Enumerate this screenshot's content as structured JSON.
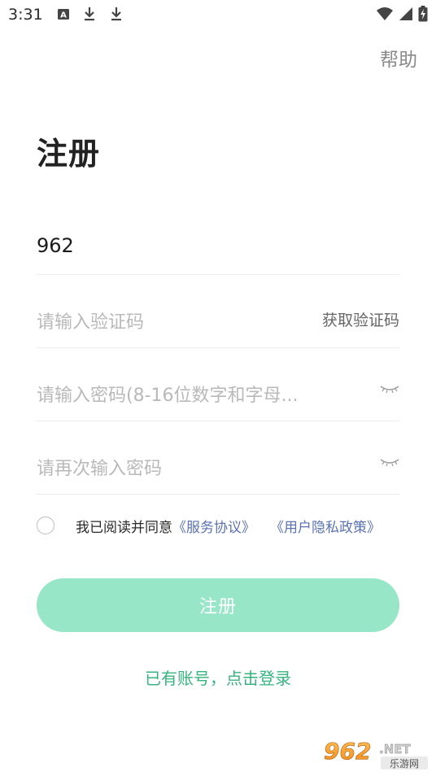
{
  "status_bar": {
    "time": "3:31",
    "icons": [
      "a-letter-icon",
      "download-icon",
      "download-icon",
      "wifi-icon",
      "signal-icon",
      "battery-charging-icon"
    ]
  },
  "header": {
    "help_label": "帮助"
  },
  "title": "注册",
  "form": {
    "phone_value": "962",
    "code_placeholder": "请输入验证码",
    "get_code_label": "获取验证码",
    "password_placeholder": "请输入密码(8-16位数字和字母...",
    "confirm_password_placeholder": "请再次输入密码"
  },
  "agreement": {
    "text": "我已阅读并同意",
    "service_link": "《服务协议》",
    "privacy_link": "《用户隐私政策》"
  },
  "register_button_label": "注册",
  "login_link_label": "已有账号，点击登录",
  "watermark": {
    "brand": "962.NET",
    "subtext": "乐游网"
  },
  "colors": {
    "accent_green": "#35b47e",
    "button_green": "#97e6c7",
    "link_blue": "#5b73b3"
  }
}
